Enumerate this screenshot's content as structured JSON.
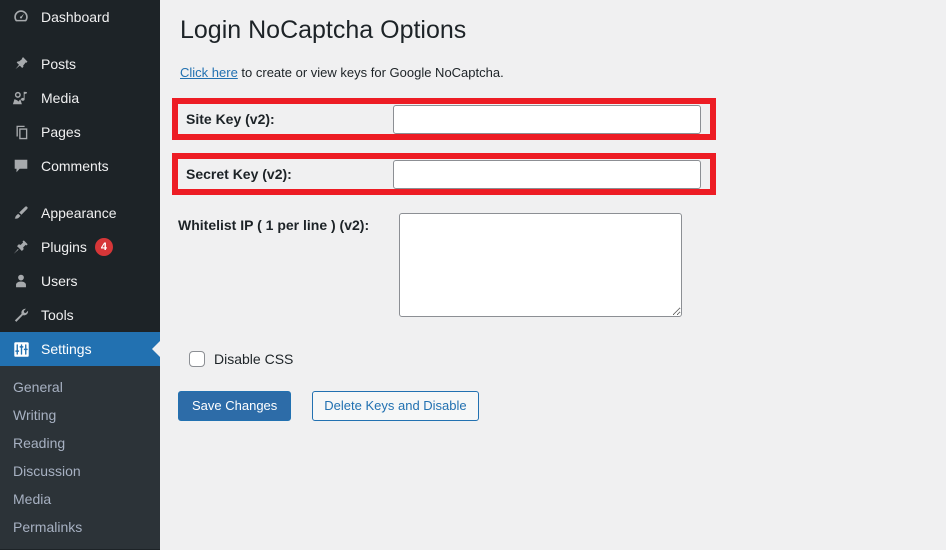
{
  "sidebar": {
    "items": [
      {
        "label": "Dashboard",
        "icon": "dashboard-icon",
        "badge": null,
        "current": false,
        "spacer_after": true
      },
      {
        "label": "Posts",
        "icon": "pin-icon",
        "badge": null,
        "current": false,
        "spacer_after": false
      },
      {
        "label": "Media",
        "icon": "media-icon",
        "badge": null,
        "current": false,
        "spacer_after": false
      },
      {
        "label": "Pages",
        "icon": "pages-icon",
        "badge": null,
        "current": false,
        "spacer_after": false
      },
      {
        "label": "Comments",
        "icon": "comment-icon",
        "badge": null,
        "current": false,
        "spacer_after": true
      },
      {
        "label": "Appearance",
        "icon": "brush-icon",
        "badge": null,
        "current": false,
        "spacer_after": false
      },
      {
        "label": "Plugins",
        "icon": "plug-icon",
        "badge": "4",
        "current": false,
        "spacer_after": false
      },
      {
        "label": "Users",
        "icon": "user-icon",
        "badge": null,
        "current": false,
        "spacer_after": false
      },
      {
        "label": "Tools",
        "icon": "wrench-icon",
        "badge": null,
        "current": false,
        "spacer_after": false
      },
      {
        "label": "Settings",
        "icon": "settings-icon",
        "badge": null,
        "current": true,
        "spacer_after": false
      }
    ],
    "submenu": [
      {
        "label": "General"
      },
      {
        "label": "Writing"
      },
      {
        "label": "Reading"
      },
      {
        "label": "Discussion"
      },
      {
        "label": "Media"
      },
      {
        "label": "Permalinks"
      }
    ]
  },
  "main": {
    "title": "Login NoCaptcha Options",
    "intro": {
      "link_text": "Click here",
      "rest_text": " to create or view keys for Google NoCaptcha."
    },
    "fields": {
      "site_key": {
        "label": "Site Key (v2):",
        "value": "",
        "placeholder": ""
      },
      "secret_key": {
        "label": "Secret Key (v2):",
        "value": "",
        "placeholder": ""
      },
      "whitelist_ip": {
        "label": "Whitelist IP ( 1 per line ) (v2):",
        "value": "",
        "placeholder": ""
      }
    },
    "checkbox": {
      "label": "Disable CSS",
      "checked": false
    },
    "buttons": {
      "save": "Save Changes",
      "delete": "Delete Keys and Disable"
    }
  },
  "colors": {
    "sidebar_bg": "#1d2327",
    "submenu_bg": "#2c3338",
    "accent_blue": "#2271b1",
    "highlight_red": "#ed1c24",
    "badge_red": "#d63638",
    "page_bg": "#f0f0f1"
  }
}
